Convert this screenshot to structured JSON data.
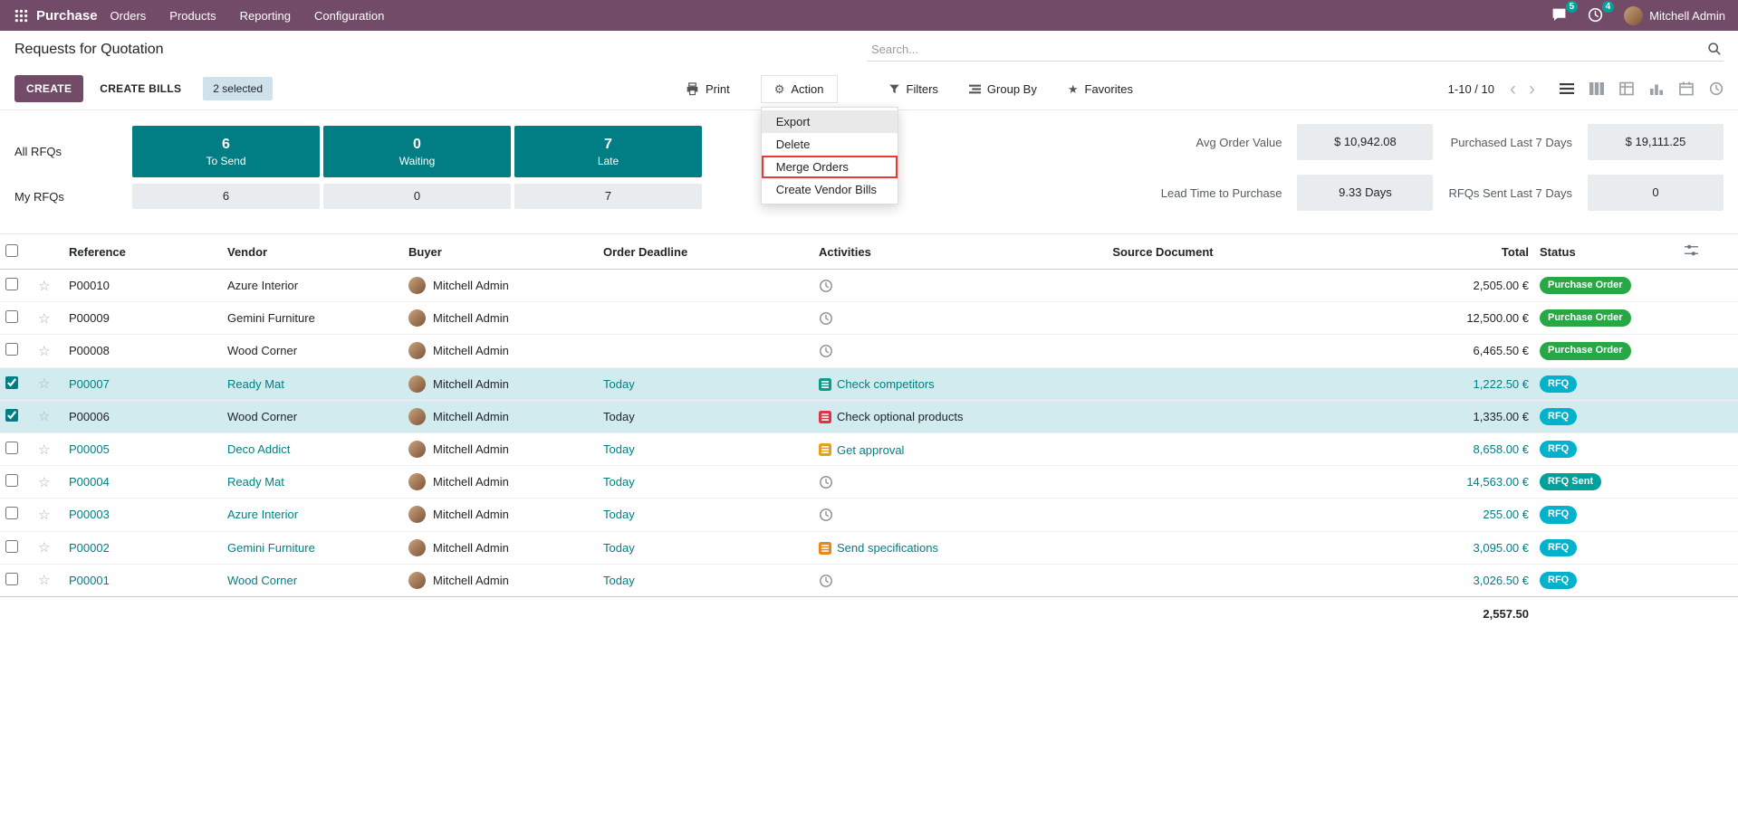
{
  "theme": {
    "navbar_bg": "#714B67",
    "primary": "#714B67",
    "teal": "#017e84",
    "selected_row_bg": "#d2ebee",
    "notification_badge": "#00a09d",
    "badge_colors": {
      "rfq": "#01b2cc",
      "rfq_sent": "#00a09d",
      "purchase_order": "#28a745"
    }
  },
  "icons": {
    "gear": "⚙",
    "star_filled": "★",
    "star_empty": "☆"
  },
  "navbar": {
    "app": "Purchase",
    "menus": [
      {
        "label": "Orders"
      },
      {
        "label": "Products"
      },
      {
        "label": "Reporting"
      },
      {
        "label": "Configuration"
      }
    ],
    "messages_count": "5",
    "activities_count": "4",
    "user": "Mitchell Admin"
  },
  "breadcrumb": {
    "title": "Requests for Quotation"
  },
  "search": {
    "placeholder": "Search..."
  },
  "buttons": {
    "create": "CREATE",
    "create_bills": "CREATE BILLS",
    "selected_count": "2 selected",
    "print": "Print",
    "action": "Action",
    "filters": "Filters",
    "group_by": "Group By",
    "favorites": "Favorites"
  },
  "action_menu": {
    "items": [
      {
        "label": "Export",
        "hovered": true,
        "highlighted": false
      },
      {
        "label": "Delete",
        "hovered": false,
        "highlighted": false
      },
      {
        "label": "Merge Orders",
        "hovered": false,
        "highlighted": true
      },
      {
        "label": "Create Vendor Bills",
        "hovered": false,
        "highlighted": false
      }
    ]
  },
  "pager": {
    "text": "1-10 / 10",
    "prev": "‹",
    "next": "›"
  },
  "dashboard": {
    "rows": [
      {
        "label": "All RFQs",
        "cells": [
          {
            "value": "6",
            "sub": "To Send"
          },
          {
            "value": "0",
            "sub": "Waiting"
          },
          {
            "value": "7",
            "sub": "Late"
          }
        ]
      },
      {
        "label": "My RFQs",
        "cells": [
          {
            "value": "6"
          },
          {
            "value": "0"
          },
          {
            "value": "7"
          }
        ]
      }
    ],
    "stats": [
      {
        "label": "Avg Order Value",
        "value": "$ 10,942.08"
      },
      {
        "label": "Purchased Last 7 Days",
        "value": "$ 19,111.25"
      },
      {
        "label": "Lead Time to Purchase",
        "value": "9.33 Days"
      },
      {
        "label": "RFQs Sent Last 7 Days",
        "value": "0"
      }
    ]
  },
  "list": {
    "headers": [
      "Reference",
      "Vendor",
      "Buyer",
      "Order Deadline",
      "Activities",
      "Source Document",
      "Total",
      "Status"
    ],
    "rows": [
      {
        "reference": "P00010",
        "vendor": "Azure Interior",
        "buyer": "Mitchell Admin",
        "deadline": "",
        "activity_icon": "clock",
        "activity_text": "",
        "activity_color": "",
        "source": "",
        "total": "2,505.00 €",
        "status": "Purchase Order",
        "status_key": "purchase_order",
        "selected": false,
        "decoration": "normal"
      },
      {
        "reference": "P00009",
        "vendor": "Gemini Furniture",
        "buyer": "Mitchell Admin",
        "deadline": "",
        "activity_icon": "clock",
        "activity_text": "",
        "activity_color": "",
        "source": "",
        "total": "12,500.00 €",
        "status": "Purchase Order",
        "status_key": "purchase_order",
        "selected": false,
        "decoration": "normal"
      },
      {
        "reference": "P00008",
        "vendor": "Wood Corner",
        "buyer": "Mitchell Admin",
        "deadline": "",
        "activity_icon": "clock",
        "activity_text": "",
        "activity_color": "",
        "source": "",
        "total": "6,465.50 €",
        "status": "Purchase Order",
        "status_key": "purchase_order",
        "selected": false,
        "decoration": "normal"
      },
      {
        "reference": "P00007",
        "vendor": "Ready Mat",
        "buyer": "Mitchell Admin",
        "deadline": "Today",
        "activity_icon": "list",
        "activity_text": "Check competitors",
        "activity_color": "#0e9a8d",
        "source": "",
        "total": "1,222.50 €",
        "status": "RFQ",
        "status_key": "rfq",
        "selected": true,
        "decoration": "info"
      },
      {
        "reference": "P00006",
        "vendor": "Wood Corner",
        "buyer": "Mitchell Admin",
        "deadline": "Today",
        "activity_icon": "list",
        "activity_text": "Check optional products",
        "activity_color": "#dc3545",
        "source": "",
        "total": "1,335.00 €",
        "status": "RFQ",
        "status_key": "rfq",
        "selected": true,
        "decoration": "normal"
      },
      {
        "reference": "P00005",
        "vendor": "Deco Addict",
        "buyer": "Mitchell Admin",
        "deadline": "Today",
        "activity_icon": "list",
        "activity_text": "Get approval",
        "activity_color": "#e4a11b",
        "source": "",
        "total": "8,658.00 €",
        "status": "RFQ",
        "status_key": "rfq",
        "selected": false,
        "decoration": "info"
      },
      {
        "reference": "P00004",
        "vendor": "Ready Mat",
        "buyer": "Mitchell Admin",
        "deadline": "Today",
        "activity_icon": "clock",
        "activity_text": "",
        "activity_color": "",
        "source": "",
        "total": "14,563.00 €",
        "status": "RFQ Sent",
        "status_key": "rfq_sent",
        "selected": false,
        "decoration": "info"
      },
      {
        "reference": "P00003",
        "vendor": "Azure Interior",
        "buyer": "Mitchell Admin",
        "deadline": "Today",
        "activity_icon": "clock",
        "activity_text": "",
        "activity_color": "",
        "source": "",
        "total": "255.00 €",
        "status": "RFQ",
        "status_key": "rfq",
        "selected": false,
        "decoration": "info"
      },
      {
        "reference": "P00002",
        "vendor": "Gemini Furniture",
        "buyer": "Mitchell Admin",
        "deadline": "Today",
        "activity_icon": "list",
        "activity_text": "Send specifications",
        "activity_color": "#e8871e",
        "source": "",
        "total": "3,095.00 €",
        "status": "RFQ",
        "status_key": "rfq",
        "selected": false,
        "decoration": "info"
      },
      {
        "reference": "P00001",
        "vendor": "Wood Corner",
        "buyer": "Mitchell Admin",
        "deadline": "Today",
        "activity_icon": "clock",
        "activity_text": "",
        "activity_color": "",
        "source": "",
        "total": "3,026.50 €",
        "status": "RFQ",
        "status_key": "rfq",
        "selected": false,
        "decoration": "info"
      }
    ],
    "footer_total": "2,557.50"
  }
}
